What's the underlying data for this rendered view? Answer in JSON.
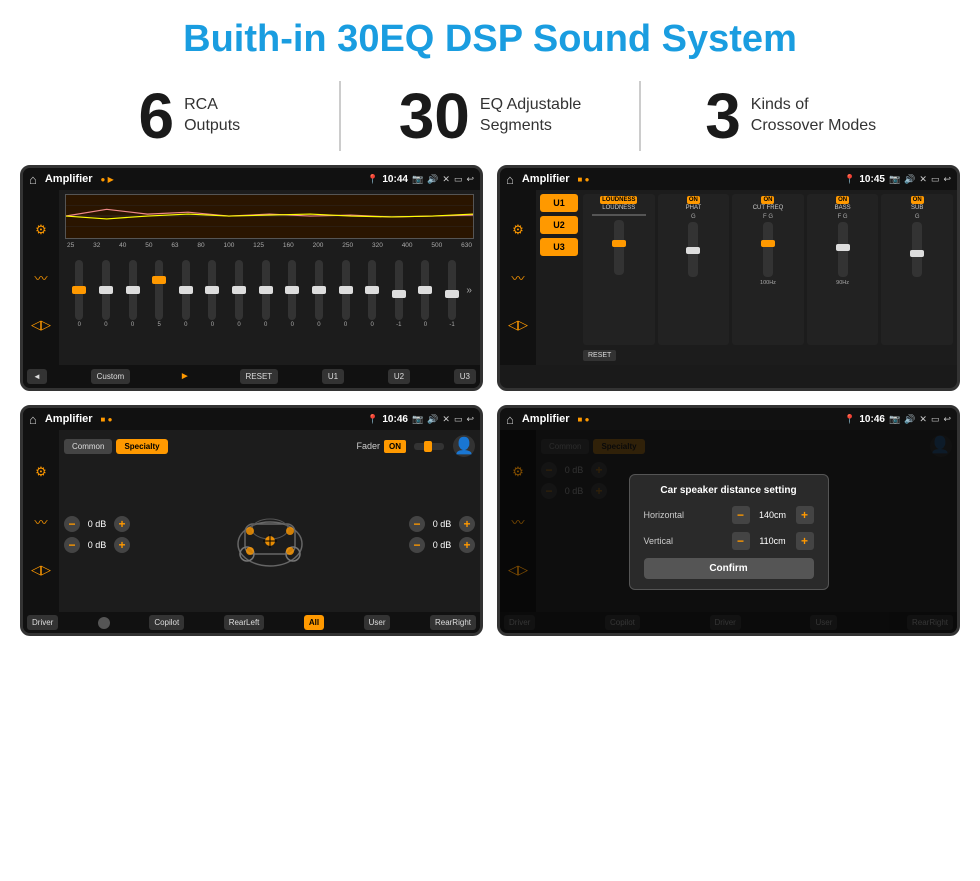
{
  "header": {
    "title": "Buith-in 30EQ DSP Sound System"
  },
  "stats": [
    {
      "number": "6",
      "line1": "RCA",
      "line2": "Outputs"
    },
    {
      "number": "30",
      "line1": "EQ Adjustable",
      "line2": "Segments"
    },
    {
      "number": "3",
      "line1": "Kinds of",
      "line2": "Crossover Modes"
    }
  ],
  "screen1": {
    "title": "Amplifier",
    "time": "10:44",
    "eq_labels": [
      "25",
      "32",
      "40",
      "50",
      "63",
      "80",
      "100",
      "125",
      "160",
      "200",
      "250",
      "320",
      "400",
      "500",
      "630"
    ],
    "eq_values": [
      0,
      0,
      0,
      5,
      0,
      0,
      0,
      0,
      0,
      0,
      0,
      0,
      -1,
      0,
      -1
    ],
    "bottom_buttons": [
      "◄",
      "Custom",
      "►",
      "RESET",
      "U1",
      "U2",
      "U3"
    ]
  },
  "screen2": {
    "title": "Amplifier",
    "time": "10:45",
    "presets": [
      "U1",
      "U2",
      "U3"
    ],
    "channels": [
      {
        "name": "LOUDNESS",
        "on": true
      },
      {
        "name": "PHAT",
        "on": true
      },
      {
        "name": "CUT FREQ",
        "on": true
      },
      {
        "name": "BASS",
        "on": true
      },
      {
        "name": "SUB",
        "on": true
      }
    ],
    "reset_label": "RESET"
  },
  "screen3": {
    "title": "Amplifier",
    "time": "10:46",
    "tabs": [
      "Common",
      "Specialty"
    ],
    "active_tab": "Specialty",
    "fader_label": "Fader",
    "fader_on": "ON",
    "vol_rows": [
      {
        "value": "0 dB"
      },
      {
        "value": "0 dB"
      },
      {
        "value": "0 dB"
      },
      {
        "value": "0 dB"
      }
    ],
    "bottom_buttons": [
      "Driver",
      "",
      "Copilot",
      "RearLeft",
      "All",
      "User",
      "RearRight"
    ],
    "active_bottom": "All"
  },
  "screen4": {
    "title": "Amplifier",
    "time": "10:46",
    "tabs": [
      "Common",
      "Specialty"
    ],
    "dialog": {
      "title": "Car speaker distance setting",
      "horizontal_label": "Horizontal",
      "horizontal_value": "140cm",
      "vertical_label": "Vertical",
      "vertical_value": "110cm",
      "confirm_label": "Confirm"
    },
    "vol_rows": [
      {
        "value": "0 dB"
      },
      {
        "value": "0 dB"
      }
    ],
    "bottom_buttons": [
      "Driver",
      "Copilot",
      "RearLeft",
      "User",
      "RearRight"
    ]
  }
}
